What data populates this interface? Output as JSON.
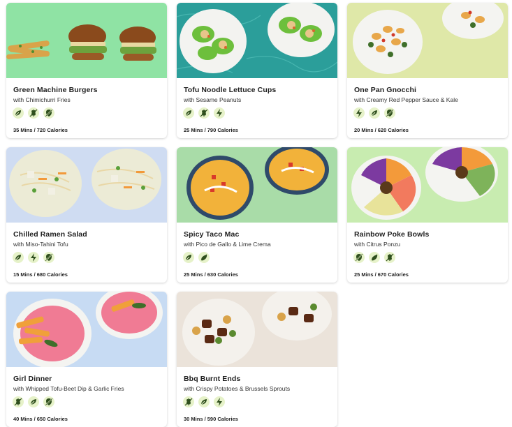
{
  "recipes": [
    {
      "title": "Green Machine Burgers",
      "subtitle": "with Chimichurri Fries",
      "time_calories": "35 Mins / 720 Calories",
      "tags": [
        "vegan-icon",
        "no-gluten-icon",
        "no-nut-icon"
      ],
      "bg": "#8fe3a4"
    },
    {
      "title": "Tofu Noodle Lettuce Cups",
      "subtitle": "with Sesame Peanuts",
      "time_calories": "25 Mins / 790 Calories",
      "tags": [
        "vegan-icon",
        "no-gluten-icon",
        "quick-icon"
      ],
      "bg": "#2b9e9a"
    },
    {
      "title": "One Pan Gnocchi",
      "subtitle": "with Creamy Red Pepper Sauce & Kale",
      "time_calories": "20 Mins / 620 Calories",
      "tags": [
        "quick-icon",
        "vegan-icon",
        "no-nut-icon"
      ],
      "bg": "#dfe8a8"
    },
    {
      "title": "Chilled Ramen Salad",
      "subtitle": "with Miso-Tahini Tofu",
      "time_calories": "15 Mins / 680 Calories",
      "tags": [
        "vegan-icon",
        "quick-icon",
        "no-nut-icon"
      ],
      "bg": "#cfdcf2"
    },
    {
      "title": "Spicy Taco Mac",
      "subtitle": "with Pico de Gallo & Lime Crema",
      "time_calories": "25 Mins / 630 Calories",
      "tags": [
        "vegan-icon",
        "spicy-icon"
      ],
      "bg": "#a9dca8"
    },
    {
      "title": "Rainbow Poke Bowls",
      "subtitle": "with Citrus Ponzu",
      "time_calories": "25 Mins / 670 Calories",
      "tags": [
        "no-nut-icon",
        "spicy-icon",
        "no-gluten-icon"
      ],
      "bg": "#c8ecb0"
    },
    {
      "title": "Girl Dinner",
      "subtitle": "with Whipped Tofu-Beet Dip & Garlic Fries",
      "time_calories": "40 Mins / 650 Calories",
      "tags": [
        "no-gluten-icon",
        "vegan-icon",
        "no-nut-icon"
      ],
      "bg": "#c7dbf3"
    },
    {
      "title": "Bbq Burnt Ends",
      "subtitle": "with Crispy Potatoes & Brussels Sprouts",
      "time_calories": "30 Mins / 590 Calories",
      "tags": [
        "no-gluten-icon",
        "vegan-icon",
        "quick-icon"
      ],
      "bg": "#ebe3da"
    }
  ],
  "colors": {
    "tag_bg": "#e6f2c9",
    "tag_fg": "#2f4f1e"
  }
}
